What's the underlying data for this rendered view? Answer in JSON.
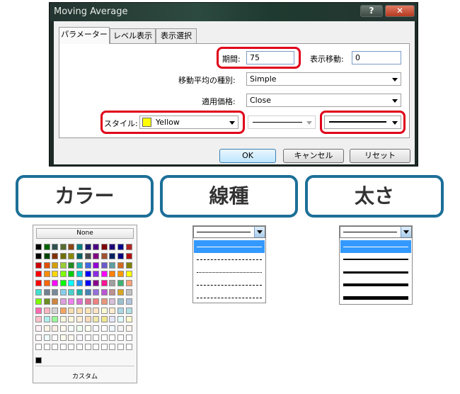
{
  "window": {
    "title": "Moving Average",
    "help_glyph": "?",
    "close_glyph": "✕"
  },
  "tabs": [
    {
      "label": "パラメーター",
      "active": true
    },
    {
      "label": "レベル表示",
      "active": false
    },
    {
      "label": "表示選択",
      "active": false
    }
  ],
  "params": {
    "period_label": "期間:",
    "period_value": "75",
    "shift_label": "表示移動:",
    "shift_value": "0",
    "ma_type_label": "移動平均の種別:",
    "ma_type_value": "Simple",
    "apply_label": "適用価格:",
    "apply_value": "Close",
    "style_label": "スタイル:",
    "color_value": "Yellow",
    "color_hex": "#ffff00"
  },
  "buttons": {
    "ok": "OK",
    "cancel": "キャンセル",
    "reset": "リセット"
  },
  "captions": {
    "color": "カラー",
    "line_type": "線種",
    "width": "太さ"
  },
  "palette": {
    "none_label": "None",
    "custom_label": "カスタム",
    "rows": [
      [
        "#000000",
        "#006400",
        "#2f4f4f",
        "#556b2f",
        "#8b4513",
        "#008080",
        "#191970",
        "#4b0082",
        "#800000",
        "#1e0078",
        "#00008b",
        "#b22222"
      ],
      [
        "#000000",
        "#004400",
        "#803000",
        "#707000",
        "#888800",
        "#006060",
        "#4a4a4a",
        "#800080",
        "#a0522d",
        "#002060",
        "#000080",
        "#b01010"
      ],
      [
        "#cd0000",
        "#e05000",
        "#d4a000",
        "#9acd32",
        "#228b22",
        "#20b2aa",
        "#4169e1",
        "#9400d3",
        "#6a5acd",
        "#5f9ea0",
        "#d2691e",
        "#808000"
      ],
      [
        "#ff0000",
        "#ff8c00",
        "#ffd700",
        "#7fff00",
        "#00cc00",
        "#00ced1",
        "#0000ff",
        "#8a2be2",
        "#ff00ff",
        "#ff8000",
        "#ff9900",
        "#ffff00"
      ],
      [
        "#ff0000",
        "#ff6600",
        "#ff00ff",
        "#00ff00",
        "#00ffff",
        "#1e90ff",
        "#0000ff",
        "#8b008b",
        "#ff1493",
        "#a0a0a0",
        "#3cb371",
        "#ffa07a"
      ],
      [
        "#40e0d0",
        "#708090",
        "#778899",
        "#87ceeb",
        "#48d1cc",
        "#20b2aa",
        "#4682b4",
        "#9370db",
        "#ba55d3",
        "#bc8f8f",
        "#daa520",
        "#c0c0c0"
      ],
      [
        "#7cfc00",
        "#6b8e23",
        "#cd853f",
        "#dda0dd",
        "#ee82ee",
        "#da70d6",
        "#db7093",
        "#f08080",
        "#e9967a",
        "#d8bfd8",
        "#9ac0cd",
        "#b0c4de"
      ],
      [
        "#ff69b4",
        "#ffb6c1",
        "#d3d3d3",
        "#f4a460",
        "#f5deb3",
        "#ffdead",
        "#ffe4b5",
        "#ffe4c4",
        "#fafad2",
        "#ffebcd",
        "#add8e6",
        "#b0e0e6"
      ],
      [
        "#ffc0cb",
        "#afeeee",
        "#98fb98",
        "#f5f5dc",
        "#fff8dc",
        "#ffefd5",
        "#ffdab9",
        "#eee8aa",
        "#f0e68c",
        "#e6e6fa",
        "#e0ffff",
        "#fffacd"
      ],
      [
        "#fff0f5",
        "#fdf5e6",
        "#faf0e6",
        "#fffaf0",
        "#f5fffa",
        "#f0fff0",
        "#fffff0",
        "#f8f8ff",
        "#ffffff",
        "#f0f8ff",
        "#f5f5f5",
        "#fff5ee"
      ],
      [
        "#fffafa",
        "#f0ffff",
        "#ffffff",
        "#fffff0",
        "#fffaf0",
        "#f8f8ff",
        "#fdfdfd",
        "#fcfcfc",
        "#ffffff",
        "#ffffff",
        "#ffffff",
        "#ffffff"
      ],
      [
        "#ffffff",
        "#ffffff",
        "#ffffff",
        "#ffffff",
        "#ffffff",
        "#ffffff",
        "#ffffff",
        "#ffffff",
        "#ffffff",
        "#ffffff",
        "#ffffff",
        "#ffffff"
      ]
    ],
    "custom_cells": [
      "#000000"
    ]
  },
  "line_styles": [
    "solid",
    "dashed",
    "dotted",
    "dash-dot",
    "dash-dot-dot"
  ],
  "line_widths": [
    1,
    2,
    3,
    4,
    5
  ]
}
